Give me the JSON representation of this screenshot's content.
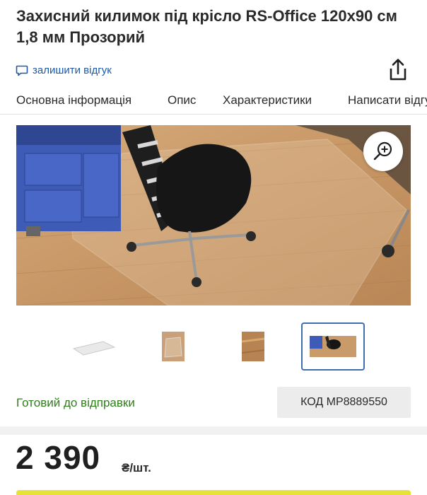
{
  "product": {
    "title": "Захисний килимок під крісло RS-Office 120x90 см 1,8 мм Прозорий",
    "review_link": "залишити відгук",
    "status": "Готовий до відправки",
    "code": "КОД MP8889550",
    "price": "2 390",
    "price_unit": "₴/шт."
  },
  "tabs": [
    {
      "label": "Основна інформація"
    },
    {
      "label": "Опис"
    },
    {
      "label": "Характеристики"
    },
    {
      "label": "Написати відгук"
    }
  ],
  "icons": {
    "review": "speech-bubble-icon",
    "share": "share-icon",
    "zoom": "zoom-in-icon"
  },
  "gallery": {
    "thumbnails": [
      "mat-only",
      "mat-on-floor",
      "mat-closeup",
      "mat-with-chair"
    ],
    "selected_index": 3
  },
  "colors": {
    "link": "#1e5aa8",
    "status": "#2e7d1b",
    "selected_thumb": "#3d6db3",
    "buy_button": "#e8e237"
  }
}
